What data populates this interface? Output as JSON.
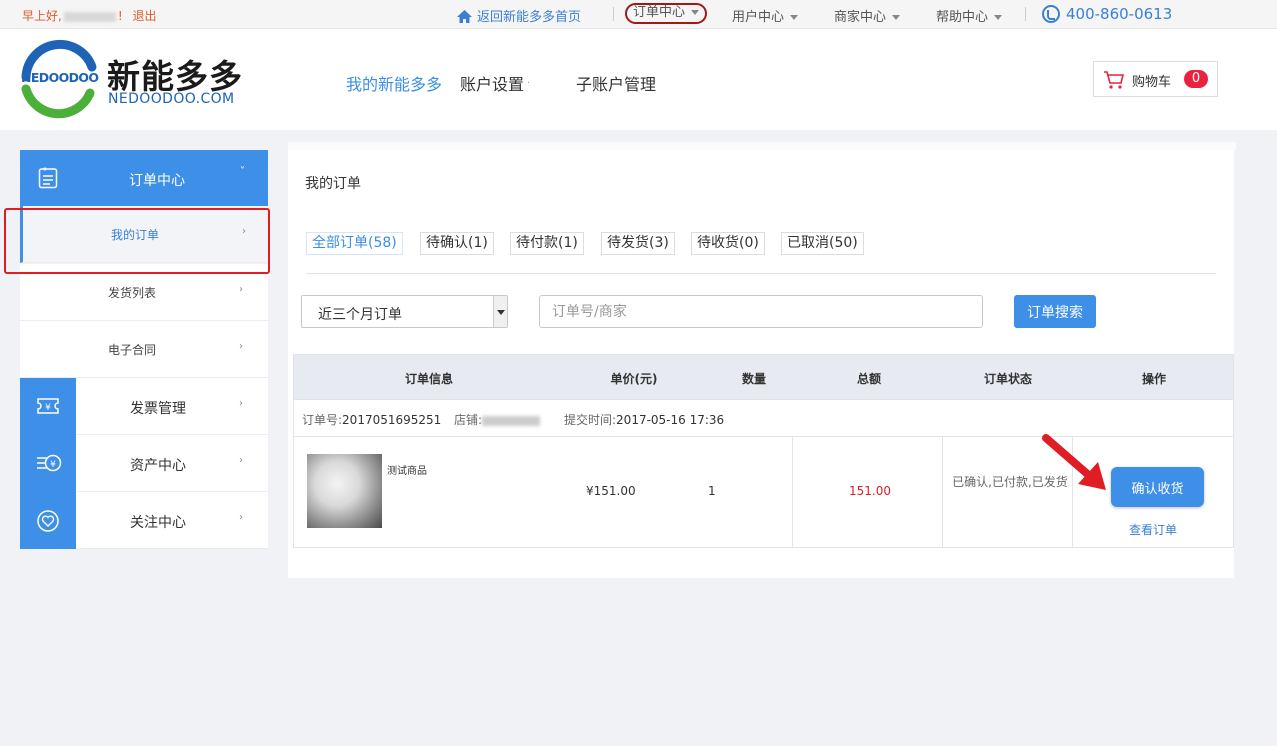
{
  "topbar": {
    "greeting_prefix": "早上好,",
    "greeting_suffix": "!",
    "logout": "退出",
    "home": "返回新能多多首页",
    "order_center": "订单中心",
    "user_center": "用户中心",
    "merchant_center": "商家中心",
    "help_center": "帮助中心",
    "phone": "400-860-0613"
  },
  "header": {
    "logo_small": "NEDOODOO",
    "logo_cn": "新能多多",
    "logo_en": "NEDOODOO.COM",
    "nav": [
      "我的新能多多",
      "账户设置",
      "子账户管理"
    ],
    "cart_label": "购物车",
    "cart_count": "0"
  },
  "sidebar": {
    "order_center": "订单中心",
    "sub": [
      "我的订单",
      "发货列表",
      "电子合同"
    ],
    "items": [
      "发票管理",
      "资产中心",
      "关注中心"
    ]
  },
  "main": {
    "title": "我的订单",
    "tabs": [
      "全部订单(58)",
      "待确认(1)",
      "待付款(1)",
      "待发货(3)",
      "待收货(0)",
      "已取消(50)"
    ],
    "filter_value": "近三个月订单",
    "search_placeholder": "订单号/商家",
    "search_button": "订单搜索"
  },
  "table": {
    "headers": [
      "订单信息",
      "单价(元)",
      "数量",
      "总额",
      "订单状态",
      "操作"
    ],
    "order": {
      "no_label": "订单号:",
      "no": "2017051695251",
      "shop_label": "店铺:",
      "time_label": "提交时间:",
      "time": "2017-05-16 17:36",
      "product": "测试商品",
      "unit_price": "¥151.00",
      "qty": "1",
      "total": "151.00",
      "status": "已确认,已付款,已发货",
      "confirm": "确认收货",
      "view": "查看订单"
    }
  },
  "colors": {
    "accent": "#3d8fe8",
    "highlight": "#e01c24"
  }
}
